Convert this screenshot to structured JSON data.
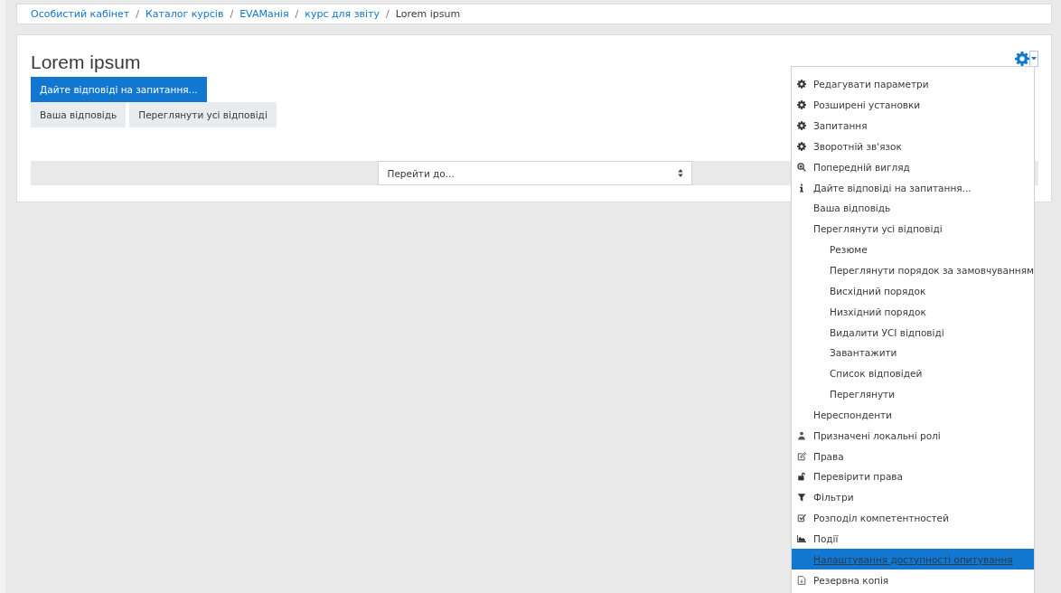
{
  "breadcrumb": [
    {
      "label": "Особистий кабінет",
      "link": true
    },
    {
      "separator": "/",
      "label": "Каталог курсів",
      "link": true
    },
    {
      "separator": "/",
      "label": "EVAМанія",
      "link": true
    },
    {
      "separator": "/",
      "label": "курс для звіту",
      "link": true
    },
    {
      "separator": "/",
      "label": "Lorem ipsum",
      "link": false
    }
  ],
  "page": {
    "title": "Lorem ipsum",
    "buttons": [
      {
        "label": "Дайте відповіді на запитання...",
        "kind": "primary"
      },
      {
        "label": "Ваша відповідь",
        "kind": "secondary"
      },
      {
        "label": "Переглянути усі відповіді",
        "kind": "secondary"
      }
    ],
    "jump": {
      "value": "Перейти до..."
    }
  },
  "menu": {
    "expanded": true,
    "items": [
      {
        "label": "Редагувати параметри",
        "kind": "settings",
        "selected": false
      },
      {
        "label": "Розширені установки",
        "kind": "settings",
        "selected": false
      },
      {
        "label": "Запитання",
        "kind": "settings",
        "selected": false
      },
      {
        "label": "Зворотній зв'язок",
        "kind": "settings",
        "selected": false
      },
      {
        "label": "Попередній вигляд",
        "kind": "preview",
        "selected": false
      },
      {
        "label": "Дайте відповіді на запитання...",
        "kind": "info",
        "selected": false
      },
      {
        "label": "Ваша відповідь",
        "selected": false
      },
      {
        "label": "Переглянути усі відповіді",
        "selected": false,
        "children": [
          {
            "label": "Резюме",
            "selected": false
          },
          {
            "label": "Переглянути порядок за замовчуванням",
            "selected": false
          },
          {
            "label": "Висхідний порядок",
            "selected": false
          },
          {
            "label": "Низхідний порядок",
            "selected": false
          },
          {
            "label": "Видалити УСІ відповіді",
            "selected": false
          },
          {
            "label": "Завантажити",
            "selected": false
          },
          {
            "label": "Список відповідей",
            "selected": false
          },
          {
            "label": "Переглянути",
            "selected": false
          }
        ]
      },
      {
        "label": "Нереспонденти",
        "selected": false
      },
      {
        "label": "Призначені локальні ролі",
        "kind": "roles",
        "selected": false
      },
      {
        "label": "Права",
        "kind": "edit",
        "selected": false
      },
      {
        "label": "Перевірити права",
        "kind": "unlock",
        "selected": false
      },
      {
        "label": "Фільтри",
        "kind": "filter",
        "selected": false
      },
      {
        "label": "Розподіл компетентностей",
        "kind": "competency",
        "selected": false
      },
      {
        "label": "Події",
        "kind": "events",
        "selected": false
      },
      {
        "label": "Налаштування доступності опитування",
        "selected": true
      },
      {
        "label": "Резервна копія",
        "kind": "backup",
        "selected": false
      }
    ]
  }
}
